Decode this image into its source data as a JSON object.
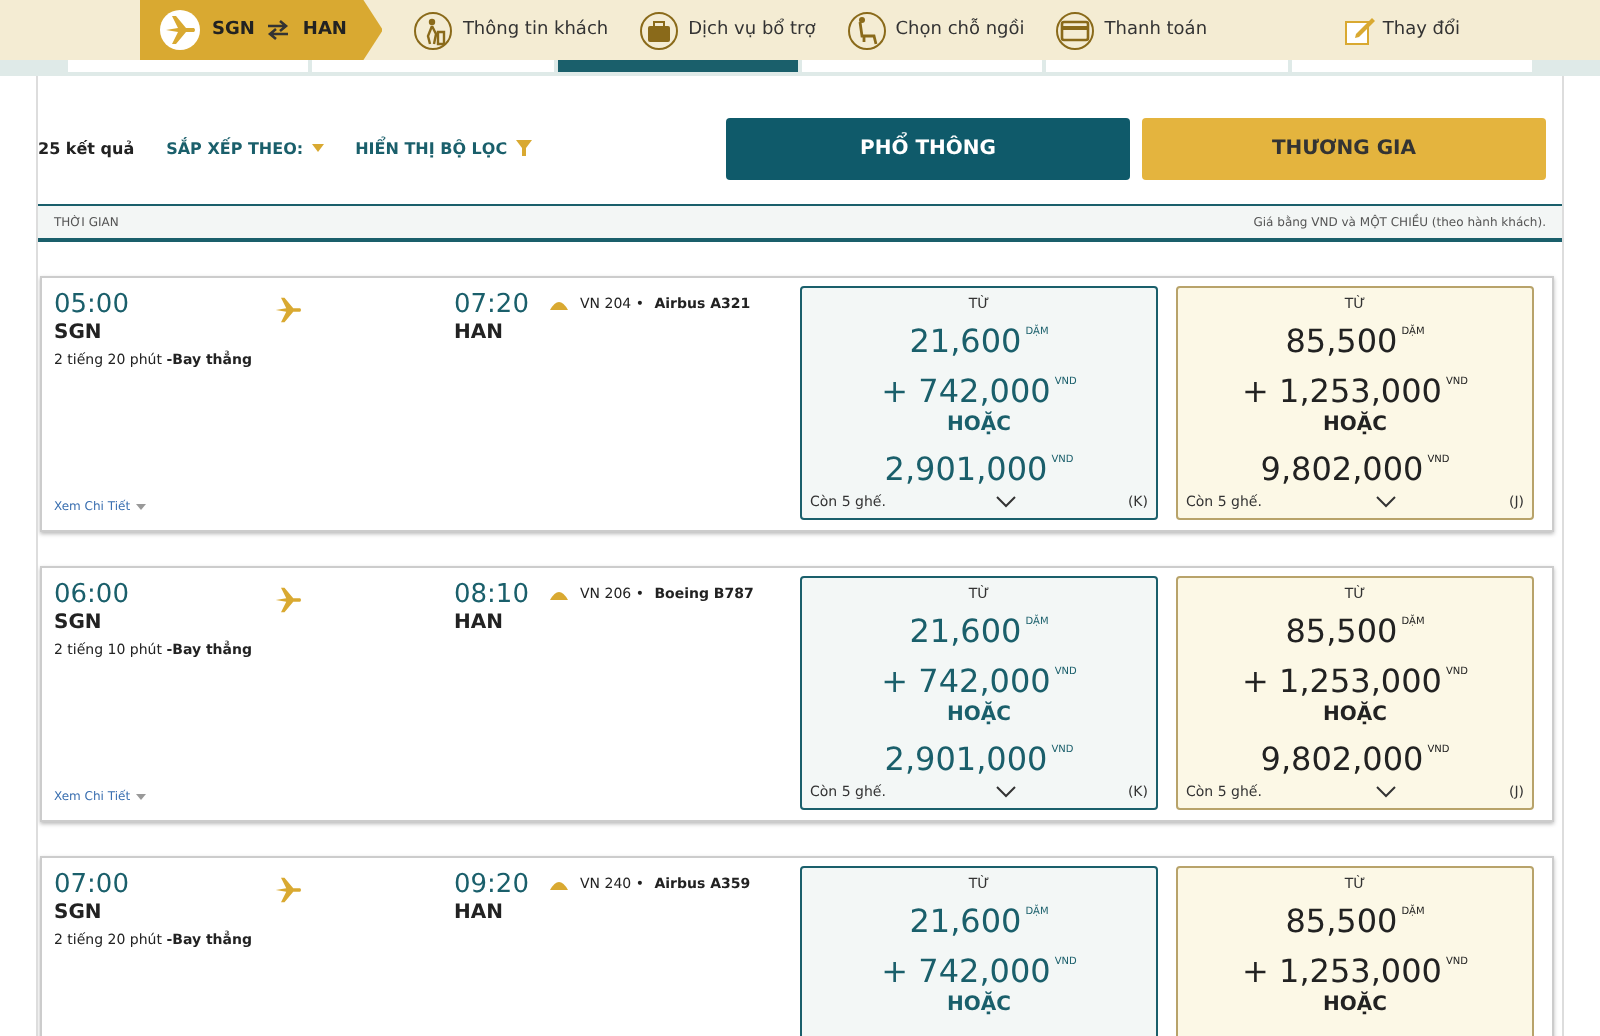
{
  "header": {
    "route": {
      "from": "SGN",
      "to": "HAN"
    },
    "steps": [
      {
        "kind": "passenger",
        "label": "Thông tin khách"
      },
      {
        "kind": "services",
        "label": "Dịch vụ bổ trợ"
      },
      {
        "kind": "seat",
        "label": "Chọn chỗ ngồi"
      },
      {
        "kind": "payment",
        "label": "Thanh toán"
      }
    ],
    "change": "Thay đổi"
  },
  "date_strip": [
    {
      "selected": false
    },
    {
      "selected": false
    },
    {
      "selected": true
    },
    {
      "selected": false
    },
    {
      "selected": false
    },
    {
      "selected": false
    }
  ],
  "toolbar": {
    "results": "25 kết quả",
    "sort": "SẮP XẾP THEO:",
    "filter": "HIỂN THỊ BỘ LỌC",
    "cabins": [
      {
        "kind": "economy",
        "label": "PHỔ THÔNG"
      },
      {
        "kind": "business",
        "label": "THƯƠNG GIA"
      }
    ]
  },
  "column_header": {
    "label": "THỜI GIAN",
    "note": "Giá bằng VND và MỘT CHIỀU (theo hành khách)."
  },
  "flights": [
    {
      "depart": "05:00",
      "from": "SGN",
      "arrive": "07:20",
      "to": "HAN",
      "duration": "2 tiếng 20 phút",
      "stops": "-Bay thẳng",
      "flight": "VN 204",
      "separator": "•",
      "aircraft": "Airbus A321",
      "details": "Xem Chi Tiết",
      "fares": [
        {
          "kind": "economy",
          "from_label": "TỪ",
          "miles": "21,600",
          "miles_unit": "DẶM",
          "cash": "+ 742,000",
          "cash_unit": "VND",
          "or": "HOẶC",
          "total": "2,901,000",
          "total_unit": "VND",
          "seats": "Còn 5 ghế.",
          "fare_class": "(K)"
        },
        {
          "kind": "business",
          "from_label": "TỪ",
          "miles": "85,500",
          "miles_unit": "DẶM",
          "cash": "+ 1,253,000",
          "cash_unit": "VND",
          "or": "HOẶC",
          "total": "9,802,000",
          "total_unit": "VND",
          "seats": "Còn 5 ghế.",
          "fare_class": "(J)"
        }
      ]
    },
    {
      "depart": "06:00",
      "from": "SGN",
      "arrive": "08:10",
      "to": "HAN",
      "duration": "2 tiếng 10 phút",
      "stops": "-Bay thẳng",
      "flight": "VN 206",
      "separator": "•",
      "aircraft": "Boeing B787",
      "details": "Xem Chi Tiết",
      "fares": [
        {
          "kind": "economy",
          "from_label": "TỪ",
          "miles": "21,600",
          "miles_unit": "DẶM",
          "cash": "+ 742,000",
          "cash_unit": "VND",
          "or": "HOẶC",
          "total": "2,901,000",
          "total_unit": "VND",
          "seats": "Còn 5 ghế.",
          "fare_class": "(K)"
        },
        {
          "kind": "business",
          "from_label": "TỪ",
          "miles": "85,500",
          "miles_unit": "DẶM",
          "cash": "+ 1,253,000",
          "cash_unit": "VND",
          "or": "HOẶC",
          "total": "9,802,000",
          "total_unit": "VND",
          "seats": "Còn 5 ghế.",
          "fare_class": "(J)"
        }
      ]
    },
    {
      "depart": "07:00",
      "from": "SGN",
      "arrive": "09:20",
      "to": "HAN",
      "duration": "2 tiếng 20 phút",
      "stops": "-Bay thẳng",
      "flight": "VN 240",
      "separator": "•",
      "aircraft": "Airbus A359",
      "fares": [
        {
          "kind": "economy",
          "from_label": "TỪ",
          "miles": "21,600",
          "miles_unit": "DẶM",
          "cash": "+ 742,000",
          "cash_unit": "VND",
          "or": "HOẶC"
        },
        {
          "kind": "business",
          "from_label": "TỪ",
          "miles": "85,500",
          "miles_unit": "DẶM",
          "cash": "+ 1,253,000",
          "cash_unit": "VND",
          "or": "HOẶC"
        }
      ]
    }
  ]
}
